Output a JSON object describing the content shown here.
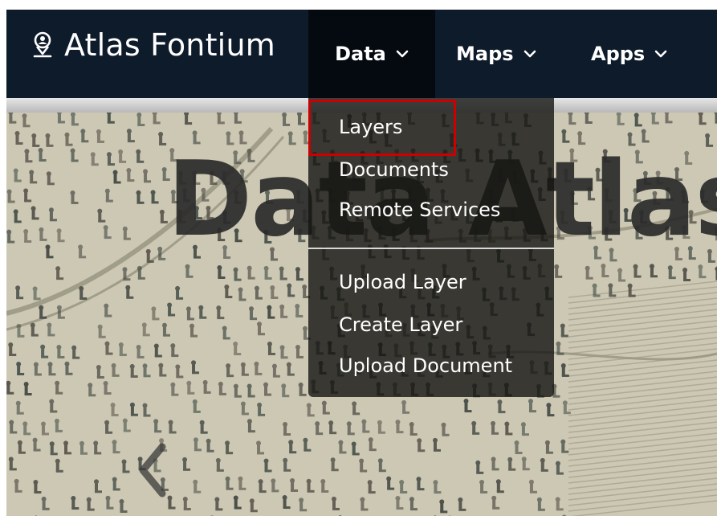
{
  "navbar": {
    "brand": "Atlas Fontium",
    "brand_icon": "map-pin-person-icon",
    "items": [
      {
        "label": "Data",
        "icon": "chevron-down-icon",
        "active": true
      },
      {
        "label": "Maps",
        "icon": "chevron-down-icon",
        "active": false
      },
      {
        "label": "Apps",
        "icon": "chevron-down-icon",
        "active": false
      }
    ]
  },
  "hero": {
    "title": "Data Atlas F",
    "prev_icon": "chevron-left-icon"
  },
  "dropdown": {
    "items": [
      {
        "label": "Layers"
      },
      {
        "label": "Documents"
      },
      {
        "label": "Remote Services"
      },
      {
        "label": "Upload Layer"
      },
      {
        "label": "Create Layer"
      },
      {
        "label": "Upload Document"
      }
    ],
    "highlight_color": "#cc0000"
  },
  "colors": {
    "navbar_bg": "#0e1b2b",
    "active_nav_bg": "#050a10",
    "dropdown_bg": "rgba(20,20,18,0.80)"
  }
}
